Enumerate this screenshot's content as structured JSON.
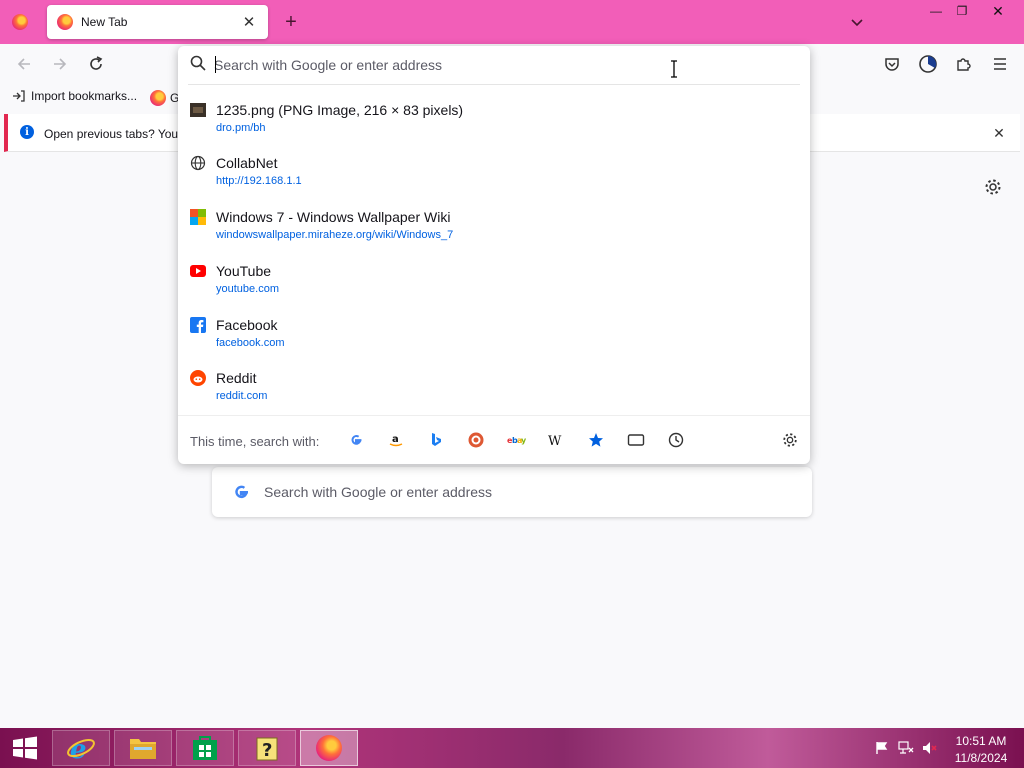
{
  "window": {
    "tab_title": "New Tab",
    "new_tab_symbol": "+",
    "close_symbol": "✕",
    "minimize_symbol": "—",
    "restore_symbol": "❐",
    "tab_bar_color": "#f25eb8"
  },
  "bookmarks": {
    "import_label": "Import bookmarks...",
    "second_label": "G"
  },
  "notification": {
    "info_symbol": "i",
    "text": "Open previous tabs? You"
  },
  "urlbar": {
    "placeholder": "Search with Google or enter address",
    "results": [
      {
        "title": "1235.png (PNG Image, 216 × 83 pixels)",
        "url": "dro.pm/bh",
        "icon": "image-thumbnail-icon"
      },
      {
        "title": "CollabNet",
        "url": "http://192.168.1.1",
        "icon": "globe-icon"
      },
      {
        "title": "Windows 7 - Windows Wallpaper Wiki",
        "url": "windowswallpaper.miraheze.org/wiki/Windows_7",
        "icon": "wiki-favicon-icon"
      },
      {
        "title": "YouTube",
        "url": "youtube.com",
        "icon": "youtube-icon"
      },
      {
        "title": "Facebook",
        "url": "facebook.com",
        "icon": "facebook-icon"
      },
      {
        "title": "Reddit",
        "url": "reddit.com",
        "icon": "reddit-icon"
      }
    ],
    "oneoff_label": "This time, search with:",
    "engines": [
      "google-icon",
      "amazon-icon",
      "bing-icon",
      "duckduckgo-icon",
      "ebay-icon",
      "wikipedia-icon",
      "bookmarks-star-icon",
      "tabs-icon",
      "history-icon"
    ]
  },
  "page": {
    "search_placeholder": "Search with Google or enter address"
  },
  "taskbar": {
    "time": "10:51 AM",
    "date": "11/8/2024"
  }
}
